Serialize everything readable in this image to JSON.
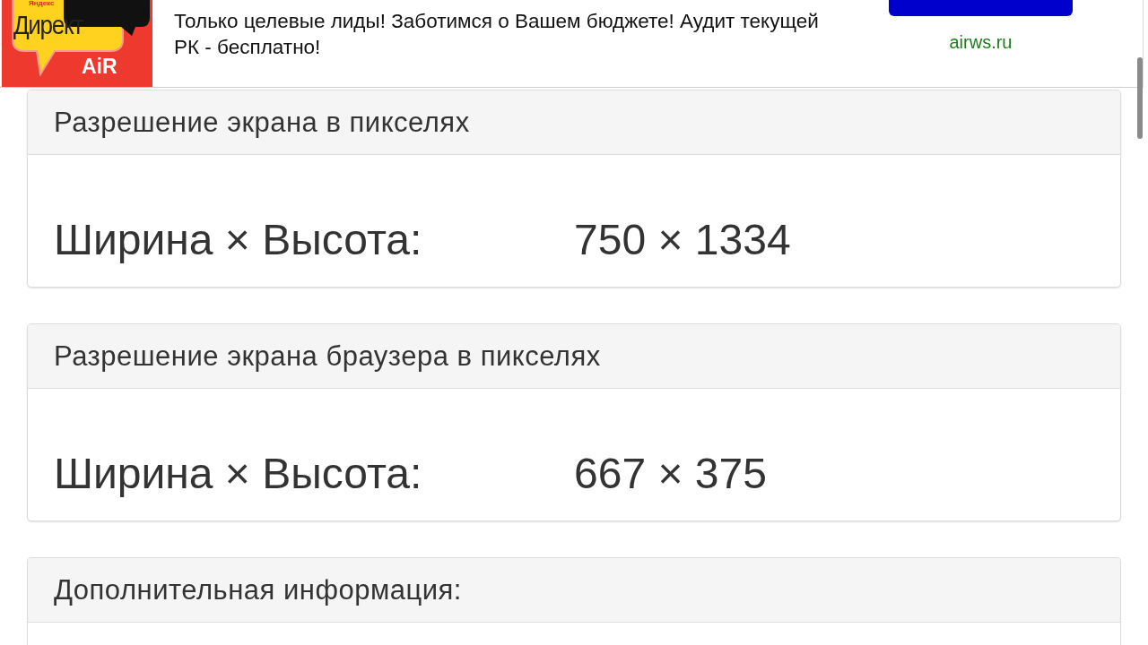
{
  "ad": {
    "logo": {
      "caption": "Яндекс",
      "title": "Директ",
      "tag": "AiR"
    },
    "text": "Только целевые лиды! Заботимся о Вашем бюджете! Аудит текущей РК - бесплатно!",
    "link": "airws.ru"
  },
  "panels": [
    {
      "title": "Разрешение экрана в пикселях",
      "label": "Ширина × Высота:",
      "value": "750 × 1334"
    },
    {
      "title": "Разрешение экрана браузера в пикселях",
      "label": "Ширина × Высота:",
      "value": "667 × 375"
    },
    {
      "title": "Дополнительная информация:"
    }
  ]
}
